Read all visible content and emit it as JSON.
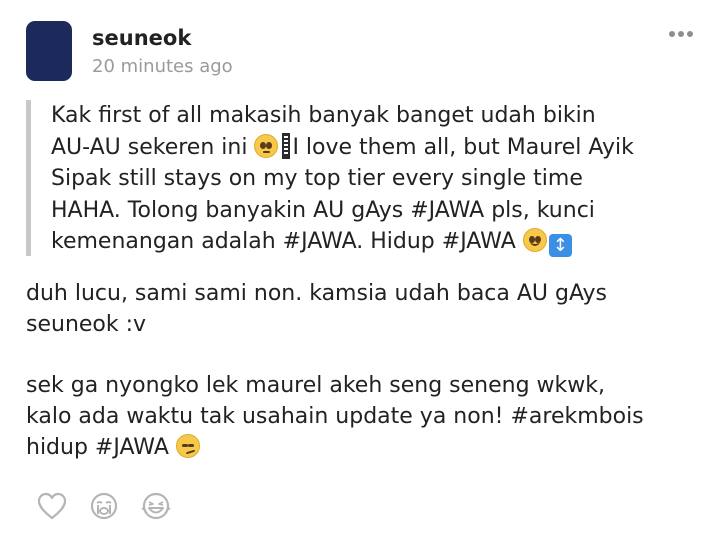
{
  "post": {
    "username": "seuneok",
    "timestamp": "20 minutes ago",
    "more_icon": "more-horizontal-icon",
    "quote": {
      "line1": "Kak first of all makasih banyak banget udah bikin",
      "line2_before": "AU-AU sekeren ini ",
      "line2_after": "I love them all, but Maurel Ayik",
      "line3": "Sipak still stays on my top tier every single time",
      "line4": "HAHA. Tolong banyakin AU gAys #JAWA pls, kunci",
      "line5": "kemenangan adalah #JAWA. Hidup #JAWA ",
      "emoji_1": "pleading-face-emoji",
      "emoji_2": "slightly-smiling-face-emoji",
      "emoji_3": "up-down-arrow-emoji"
    },
    "reply": {
      "line1": "duh lucu, sami sami non. kamsia udah baca AU gAys",
      "line2": "seuneok :v",
      "line3": "sek ga nyongko lek maurel akeh seng seneng wkwk,",
      "line4": "kalo ada waktu tak usahain update ya non! #arekmbois",
      "line5": "hidup #JAWA ",
      "emoji": "smirking-face-emoji"
    },
    "reactions": [
      {
        "icon": "heart-icon"
      },
      {
        "icon": "crying-face-icon"
      },
      {
        "icon": "laughing-face-icon"
      }
    ],
    "colors": {
      "avatar": "#1b2a5a",
      "quote_bar": "#c8c8c8",
      "muted_text": "#9a9a9a",
      "reaction_icon": "#b5b5b5"
    }
  }
}
